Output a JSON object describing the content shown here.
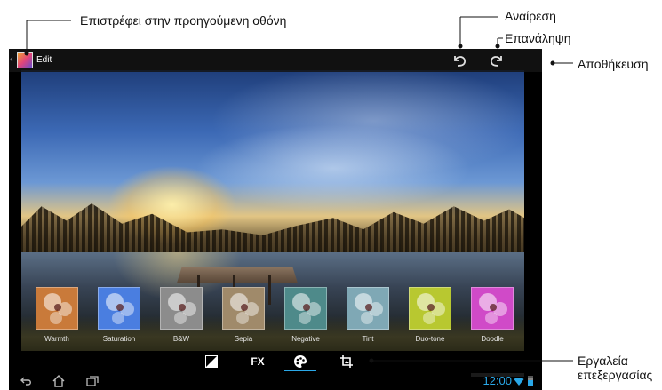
{
  "annotations": {
    "back": "Επιστρέφει στην προηγούμενη οθόνη",
    "undo": "Αναίρεση",
    "redo": "Επανάληψη",
    "save": "Αποθήκευση",
    "tools_line1": "Εργαλεία",
    "tools_line2": "επεξεργασίας"
  },
  "actionbar": {
    "title": "Edit",
    "icons": [
      "app-icon",
      "undo-icon",
      "redo-icon"
    ]
  },
  "filters": [
    {
      "label": "Warmth",
      "color": "#c97a3a"
    },
    {
      "label": "Saturation",
      "color": "#4a7ee0"
    },
    {
      "label": "B&W",
      "color": "#8c8c8c"
    },
    {
      "label": "Sepia",
      "color": "#a08a6a"
    },
    {
      "label": "Negative",
      "color": "#4e8a8a"
    },
    {
      "label": "Tint",
      "color": "#7fa8b5"
    },
    {
      "label": "Duo-tone",
      "color": "#b8c830"
    },
    {
      "label": "Doodle",
      "color": "#d04ac8"
    }
  ],
  "tools": {
    "items": [
      "contrast-icon",
      "fx",
      "palette-icon",
      "crop-icon"
    ],
    "fx_label": "FX",
    "active_index": 2
  },
  "statusbar": {
    "time": "12:00",
    "nav_icons": [
      "back-icon",
      "home-icon",
      "recent-apps-icon"
    ]
  },
  "colors": {
    "accent": "#2aa8e8"
  }
}
